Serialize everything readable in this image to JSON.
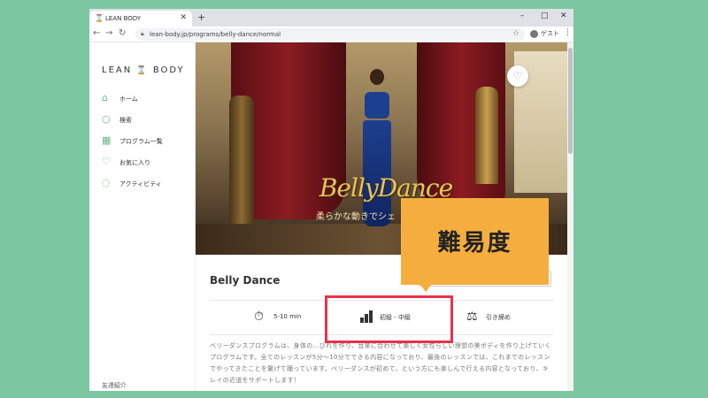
{
  "browser": {
    "tab_title": "LEAN BODY",
    "tab_close": "✕",
    "new_tab": "+",
    "window_controls": [
      "–",
      "□",
      "✕"
    ],
    "nav": {
      "back": "←",
      "forward": "→",
      "reload": "↻"
    },
    "url": "lean-body.jp/programs/belly-dance/normal",
    "guest_label": "ゲスト",
    "menu": "⋮"
  },
  "sidebar": {
    "logo_left": "LEAN",
    "logo_right": "BODY",
    "items": [
      {
        "label": "ホーム",
        "icon": "home-icon"
      },
      {
        "label": "検索",
        "icon": "search-icon"
      },
      {
        "label": "プログラム一覧",
        "icon": "grid-icon"
      },
      {
        "label": "お気に入り",
        "icon": "heart-icon"
      },
      {
        "label": "アクティビティ",
        "icon": "flame-icon"
      }
    ],
    "footer_link": "友達紹介"
  },
  "hero": {
    "title": "BellyDance",
    "subtitle": "柔らかな動きでシェ"
  },
  "program": {
    "title": "Belly Dance",
    "info": [
      {
        "label": "5-10 min",
        "icon": "stopwatch-icon"
      },
      {
        "label": "初級 - 中級",
        "icon": "difficulty-bars-icon"
      },
      {
        "label": "引き締め",
        "icon": "weight-scale-icon"
      }
    ],
    "description": "ベリーダンスプログラムは、身体の…びれを作り、音楽に合わせて楽しく女性らしい理想の美ボディを作り上げていくプログラムです。全てのレッスンが5分〜10分でできる内容になっており、最後のレッスンでは、これまでのレッスンでやってきたことを繋げて踊っています。ベリーダンスが初めて、という方にも楽しんで行える内容となっており、キレイの近道をサポートします！"
  },
  "annotation": {
    "callout_text": "難易度",
    "callout_color": "#f5ae3e",
    "highlight_color": "#e8324a"
  }
}
